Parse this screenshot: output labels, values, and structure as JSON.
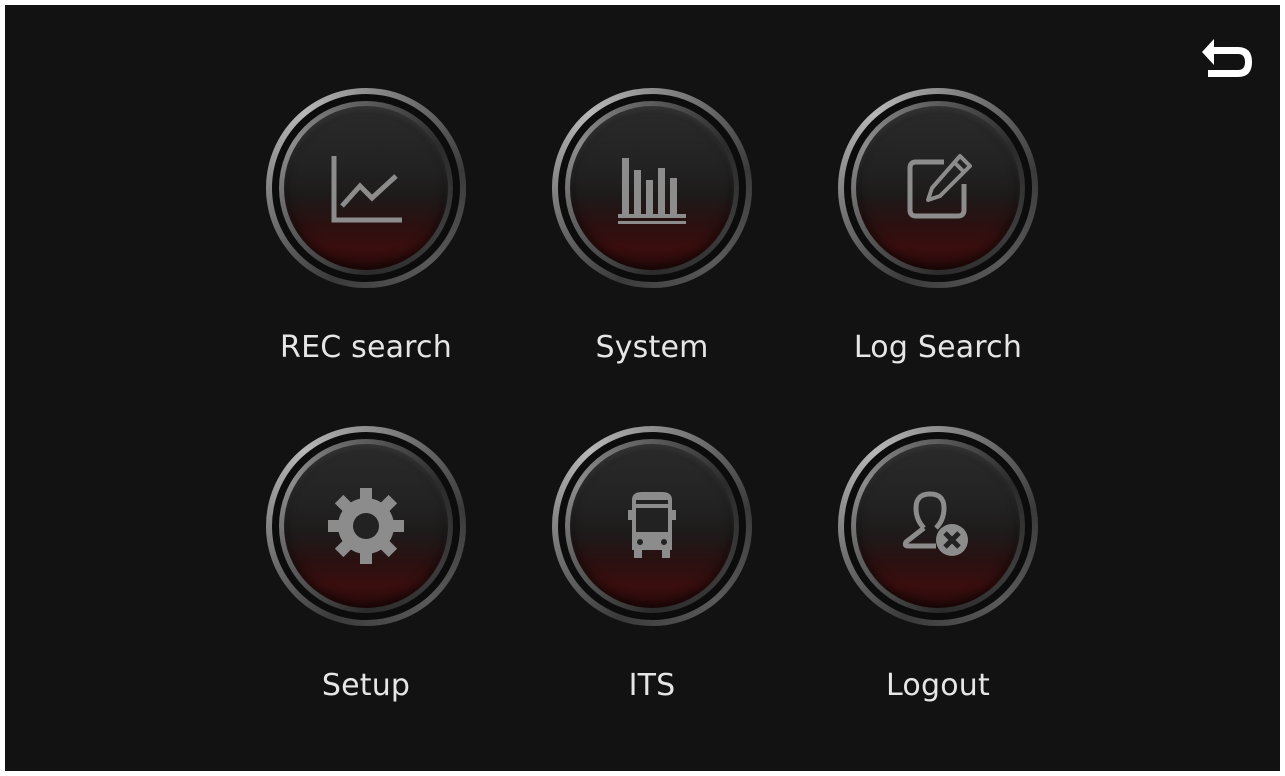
{
  "header": {
    "back_icon": "back-arrow-icon"
  },
  "menu": {
    "items": [
      {
        "label": "REC search",
        "icon": "line-chart-icon"
      },
      {
        "label": "System",
        "icon": "bar-chart-icon"
      },
      {
        "label": "Log Search",
        "icon": "edit-pencil-icon"
      },
      {
        "label": "Setup",
        "icon": "gear-icon"
      },
      {
        "label": "ITS",
        "icon": "bus-icon"
      },
      {
        "label": "Logout",
        "icon": "user-remove-icon"
      }
    ]
  },
  "colors": {
    "background": "#121212",
    "icon": "#8a8a8a",
    "label": "#e6e6e6",
    "accent": "#3a0e0e"
  }
}
